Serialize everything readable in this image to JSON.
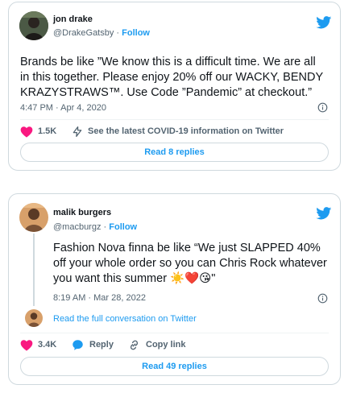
{
  "tweet1": {
    "display_name": "jon drake",
    "handle": "@DrakeGatsby",
    "separator": "·",
    "follow_label": "Follow",
    "text_lines": [
      "Brands be like ”We know this is a difficult time. We are all",
      "in this together. Please enjoy 20% off our WACKY, BENDY",
      "KRAZYSTRAWS™. Use Code ”Pandemic” at checkout.”"
    ],
    "timestamp": "4:47 PM · Apr 4, 2020",
    "likes": "1.5K",
    "covid_link": "See the latest COVID-19 information on Twitter",
    "replies_button": "Read 8 replies"
  },
  "tweet2": {
    "display_name": "malik burgers",
    "handle": "@macburgz",
    "separator": "·",
    "follow_label": "Follow",
    "text_lines": [
      "Fashion Nova finna be like “We just SLAPPED 40%",
      "off your whole order so you can Chris Rock whatever",
      "you want this summer"
    ],
    "emoji_suffix": "☀️❤️😘\"",
    "timestamp": "8:19 AM · Mar 28, 2022",
    "conversation_link": "Read the full conversation on Twitter",
    "likes": "3.4K",
    "reply_label": "Reply",
    "copy_link_label": "Copy link",
    "replies_button": "Read 49 replies"
  },
  "colors": {
    "twitter_blue": "#1d9bf0",
    "like_red": "#f91880",
    "text_gray": "#536471",
    "border": "#cfd9de"
  },
  "icons": [
    "twitter-bird-icon",
    "info-icon",
    "heart-icon",
    "lightning-icon",
    "reply-bubble-icon",
    "link-icon"
  ]
}
